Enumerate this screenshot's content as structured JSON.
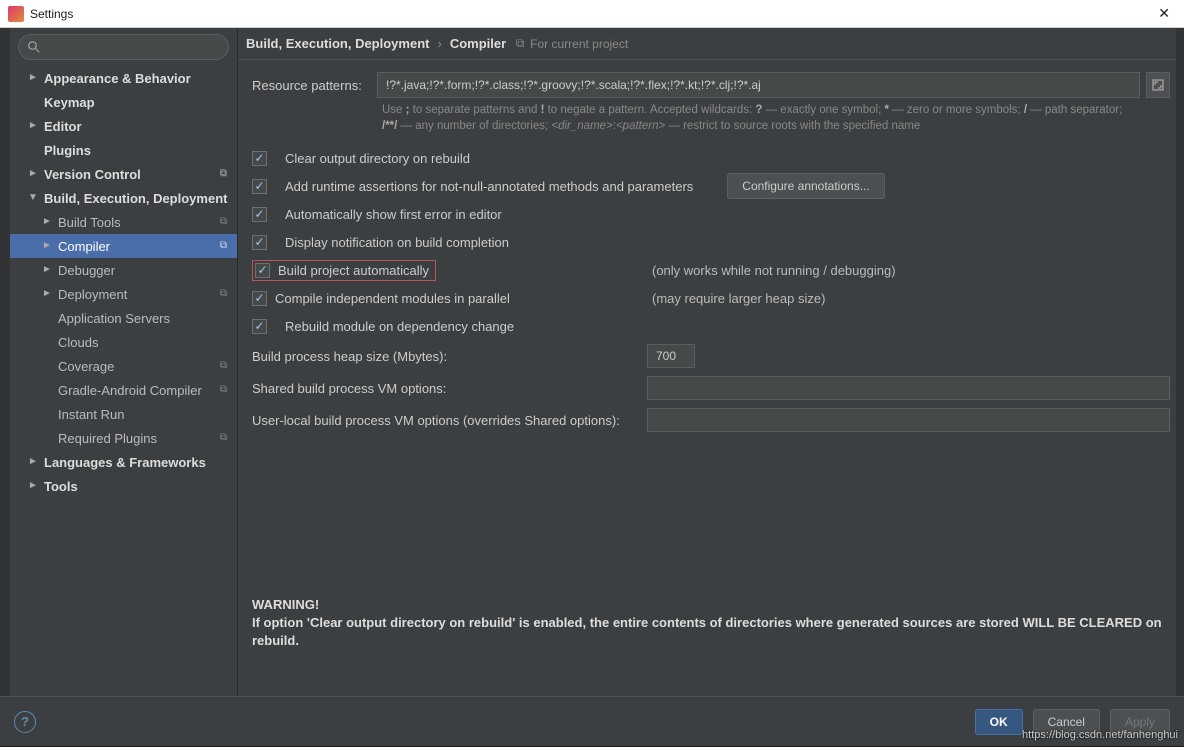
{
  "window": {
    "title": "Settings"
  },
  "search": {
    "placeholder": ""
  },
  "tree": [
    {
      "label": "Appearance & Behavior",
      "level": 1,
      "chev": "►"
    },
    {
      "label": "Keymap",
      "level": 1,
      "chev": ""
    },
    {
      "label": "Editor",
      "level": 1,
      "chev": "►"
    },
    {
      "label": "Plugins",
      "level": 1,
      "chev": ""
    },
    {
      "label": "Version Control",
      "level": 1,
      "chev": "►",
      "badge": "⧉"
    },
    {
      "label": "Build, Execution, Deployment",
      "level": 1,
      "chev": "▼"
    },
    {
      "label": "Build Tools",
      "level": 2,
      "chev": "►",
      "badge": "⧉"
    },
    {
      "label": "Compiler",
      "level": 2,
      "chev": "►",
      "badge": "⧉",
      "selected": true
    },
    {
      "label": "Debugger",
      "level": 2,
      "chev": "►"
    },
    {
      "label": "Deployment",
      "level": 2,
      "chev": "►",
      "badge": "⧉"
    },
    {
      "label": "Application Servers",
      "level": 2,
      "chev": ""
    },
    {
      "label": "Clouds",
      "level": 2,
      "chev": ""
    },
    {
      "label": "Coverage",
      "level": 2,
      "chev": "",
      "badge": "⧉"
    },
    {
      "label": "Gradle-Android Compiler",
      "level": 2,
      "chev": "",
      "badge": "⧉"
    },
    {
      "label": "Instant Run",
      "level": 2,
      "chev": ""
    },
    {
      "label": "Required Plugins",
      "level": 2,
      "chev": "",
      "badge": "⧉"
    },
    {
      "label": "Languages & Frameworks",
      "level": 1,
      "chev": "►"
    },
    {
      "label": "Tools",
      "level": 1,
      "chev": "►"
    }
  ],
  "breadcrumb": {
    "root": "Build, Execution, Deployment",
    "sep": "›",
    "leaf": "Compiler",
    "project_note": "For current project",
    "proj_icon": "⧉"
  },
  "form": {
    "resource_patterns_label": "Resource patterns:",
    "resource_patterns_value": "!?*.java;!?*.form;!?*.class;!?*.groovy;!?*.scala;!?*.flex;!?*.kt;!?*.clj;!?*.aj",
    "hint1_pre": "Use ",
    "hint1_semi": ";",
    "hint1_mid1": " to separate patterns and ",
    "hint1_bang": "!",
    "hint1_mid2": " to negate a pattern. Accepted wildcards: ",
    "hint1_q": "?",
    "hint1_mid3": " — exactly one symbol; ",
    "hint1_star": "*",
    "hint1_mid4": " — zero or more symbols; ",
    "hint1_slash": "/",
    "hint1_mid5": " — path separator;",
    "hint2_pre": "/**/",
    "hint2_mid1": " — any number of directories; ",
    "hint2_dir": "<dir_name>",
    "hint2_colon": ":",
    "hint2_pat": "<pattern>",
    "hint2_mid2": " — restrict to source roots with the specified name",
    "chk_clear": "Clear output directory on rebuild",
    "chk_assert": "Add runtime assertions for not-null-annotated methods and parameters",
    "btn_configure": "Configure annotations...",
    "chk_autoerr": "Automatically show first error in editor",
    "chk_notify": "Display notification on build completion",
    "chk_auto": "Build project automatically",
    "chk_auto_note": "(only works while not running / debugging)",
    "chk_parallel": "Compile independent modules in parallel",
    "chk_parallel_note": "(may require larger heap size)",
    "chk_rebuild_dep": "Rebuild module on dependency change",
    "heap_label": "Build process heap size (Mbytes):",
    "heap_value": "700",
    "shared_vm_label": "Shared build process VM options:",
    "shared_vm_value": "",
    "user_vm_label": "User-local build process VM options (overrides Shared options):",
    "user_vm_value": "",
    "warning_title": "WARNING!",
    "warning_text": "If option 'Clear output directory on rebuild' is enabled, the entire contents of directories where generated sources are stored WILL BE CLEARED on rebuild."
  },
  "footer": {
    "ok": "OK",
    "cancel": "Cancel",
    "apply": "Apply",
    "help": "?"
  },
  "watermark": "https://blog.csdn.net/fanhenghui"
}
